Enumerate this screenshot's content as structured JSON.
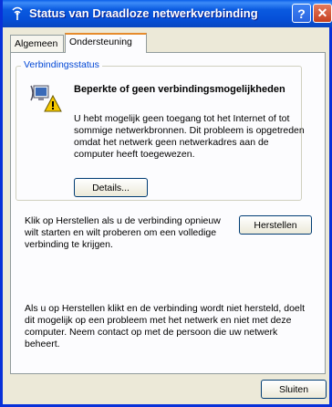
{
  "window": {
    "title": "Status van Draadloze netwerkverbinding",
    "help_label": "?",
    "close_label": "✕"
  },
  "tabs": [
    {
      "label": "Algemeen",
      "active": false
    },
    {
      "label": "Ondersteuning",
      "active": true
    }
  ],
  "status_group": {
    "legend": "Verbindingsstatus",
    "icon": "warning-network-icon",
    "heading": "Beperkte of geen verbindingsmogelijkheden",
    "message": "U hebt mogelijk geen toegang tot het Internet of tot sommige netwerkbronnen. Dit probleem is opgetreden omdat het netwerk geen netwerkadres aan de computer heeft toegewezen.",
    "details_label": "Details..."
  },
  "repair": {
    "text": "Klik op Herstellen als u de verbinding opnieuw wilt starten en wilt proberen om een volledige verbinding te krijgen.",
    "button_label": "Herstellen"
  },
  "note": "Als u op Herstellen klikt en de verbinding wordt niet hersteld, doelt dit mogelijk op een probleem met het netwerk en niet met deze computer. Neem contact op met de persoon die uw netwerk beheert.",
  "footer": {
    "close_label": "Sluiten"
  },
  "colors": {
    "titlebar": "#0a5ae0",
    "legend": "#0046d5",
    "tab_highlight": "#e68b2c",
    "warning": "#f5c800"
  }
}
